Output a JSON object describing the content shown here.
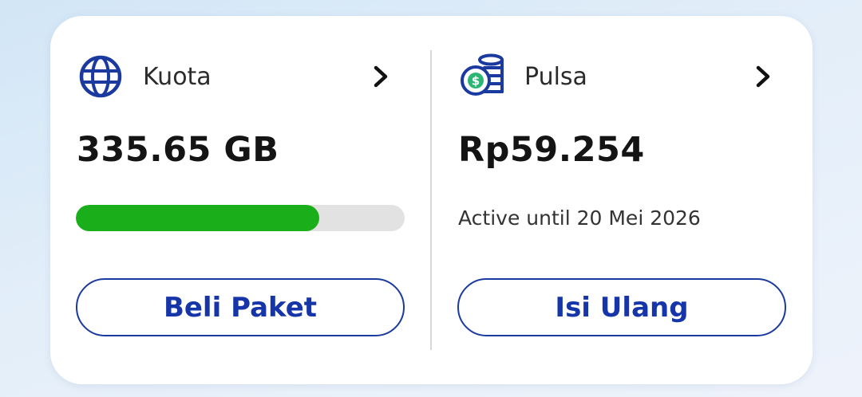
{
  "kuota": {
    "label": "Kuota",
    "icon": "globe-icon",
    "value": "335.65 GB",
    "usage_fraction": 0.74,
    "button_label": "Beli Paket"
  },
  "pulsa": {
    "label": "Pulsa",
    "icon": "coins-dollar-icon",
    "value": "Rp59.254",
    "active_text": "Active until 20 Mei 2026",
    "button_label": "Isi Ulang"
  },
  "colors": {
    "accent": "#1a3aa0",
    "progress": "#1aaf1a",
    "track": "#e2e2e2"
  }
}
